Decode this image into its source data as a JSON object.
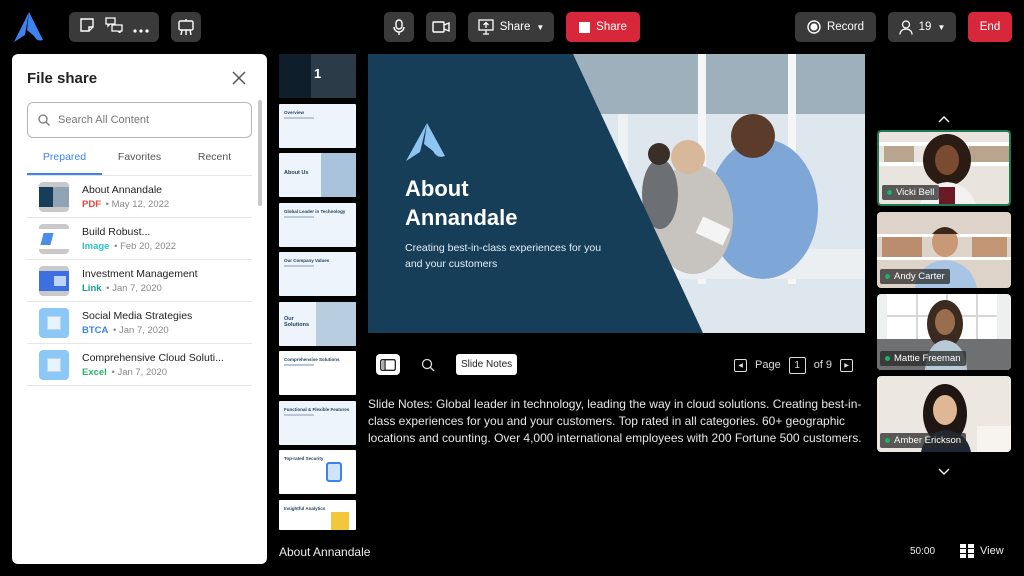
{
  "toolbar": {
    "share_menu_label": "Share",
    "stop_share_label": "Share",
    "record_label": "Record",
    "participants_count": "19",
    "end_label": "End"
  },
  "file_share": {
    "title": "File share",
    "search_placeholder": "Search All Content",
    "tabs": [
      {
        "label": "Prepared",
        "active": true
      },
      {
        "label": "Favorites",
        "active": false
      },
      {
        "label": "Recent",
        "active": false
      }
    ],
    "files": [
      {
        "name": "About Annandale",
        "type": "PDF",
        "type_color": "#e8453c",
        "date": "May 12, 2022",
        "thumb": "slide"
      },
      {
        "name": "Build Robust...",
        "type": "Image",
        "type_color": "#2bc3c8",
        "date": "Feb 20, 2022",
        "thumb": "image"
      },
      {
        "name": "Investment Management",
        "type": "Link",
        "type_color": "#159e9a",
        "date": "Jan 7, 2020",
        "thumb": "link"
      },
      {
        "name": "Social Media Strategies",
        "type": "BTCA",
        "type_color": "#3d82f0",
        "date": "Jan 7, 2020",
        "thumb": "cube"
      },
      {
        "name": "Comprehensive Cloud Soluti...",
        "type": "Excel",
        "type_color": "#2db56a",
        "date": "Jan 7, 2020",
        "thumb": "cube"
      }
    ]
  },
  "slide_thumbnails": [
    {
      "title": "About Annandale",
      "current_number": "1"
    },
    {
      "title": "Overview"
    },
    {
      "title": "About Us"
    },
    {
      "title": "Global Leader in Technology"
    },
    {
      "title": "Our Company Values"
    },
    {
      "title": "Our Solutions"
    },
    {
      "title": "Comprehensive Solutions"
    },
    {
      "title": "Functional & Flexible Features"
    },
    {
      "title": "Top-rated Security"
    },
    {
      "title": "Insightful Analytics"
    }
  ],
  "slide": {
    "title_line1": "About",
    "title_line2": "Annandale",
    "subtitle": "Creating best-in-class experiences for you and your customers"
  },
  "slide_controls": {
    "notes_button_label": "Slide Notes",
    "page_label": "Page",
    "current_page": "1",
    "total_label": "of 9"
  },
  "slide_notes": "Slide Notes: Global leader in technology, leading the way in cloud solutions. Creating best-in-class experiences for you and your customers. Top rated in all categories. 60+ geographic locations and counting. Over 4,000 international employees with 200 Fortune 500 customers.",
  "participants": [
    {
      "name": "Vicki Bell",
      "active_speaker": true
    },
    {
      "name": "Andy Carter",
      "active_speaker": false
    },
    {
      "name": "Mattie Freeman",
      "active_speaker": false
    },
    {
      "name": "Amber Erickson",
      "active_speaker": false
    }
  ],
  "footer": {
    "presentation_title": "About Annandale",
    "timer": "50:00",
    "view_label": "View"
  },
  "colors": {
    "brand_blue": "#3d82f0",
    "danger_red": "#d7283b",
    "slide_navy": "#173e59",
    "active_speaker_green": "#1f7a52"
  }
}
